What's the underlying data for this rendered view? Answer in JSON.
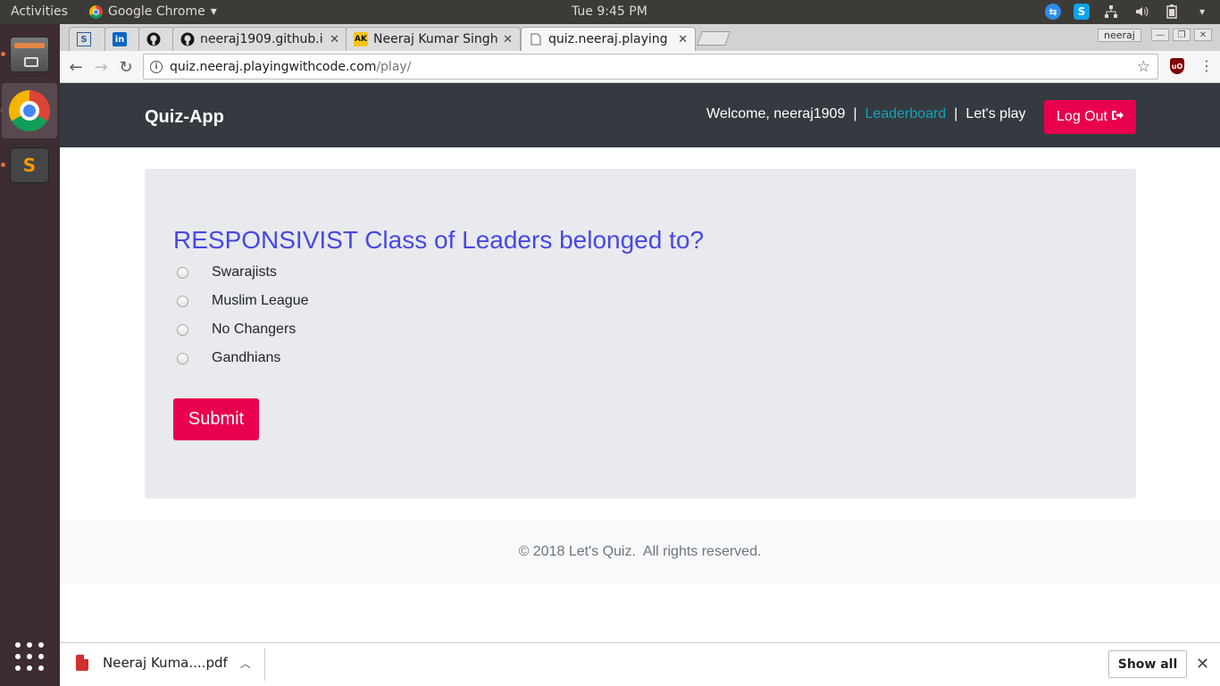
{
  "top_panel": {
    "activities": "Activities",
    "app_name": "Google Chrome",
    "app_menu_arrow": "▾",
    "clock": "Tue  9:45 PM"
  },
  "launcher": {
    "items": [
      "Files",
      "Google Chrome",
      "Sublime Text"
    ],
    "sublime_glyph": "S"
  },
  "browser": {
    "tabs": [
      {
        "favicon": "S",
        "title": ""
      },
      {
        "favicon": "in",
        "title": ""
      },
      {
        "favicon": "github",
        "title": ""
      },
      {
        "favicon": "github",
        "title": "neeraj1909.github.i",
        "close": "✕"
      },
      {
        "favicon": "AK",
        "title": "Neeraj Kumar Singh",
        "close": "✕"
      },
      {
        "favicon": "doc",
        "title": "quiz.neeraj.playing",
        "close": "✕"
      }
    ],
    "profile_name": "neeraj",
    "url_host": "quiz.neeraj.playingwithcode.com",
    "url_path": "/play/",
    "ublock_label": "uO"
  },
  "page": {
    "brand": "Quiz-App",
    "welcome": "Welcome, neeraj1909",
    "separator": "|",
    "leaderboard": "Leaderboard",
    "lets_play": "Let's play",
    "logout": "Log Out",
    "question": "RESPONSIVIST Class of Leaders belonged to?",
    "options": [
      "Swarajists",
      "Muslim League",
      "No Changers",
      "Gandhians"
    ],
    "submit": "Submit",
    "footer": "© 2018 Let's Quiz.  All rights reserved."
  },
  "download_shelf": {
    "file_name": "Neeraj Kuma....pdf",
    "show_all": "Show all"
  },
  "colors": {
    "accent": "#e8004e",
    "navbar": "#343a40",
    "question": "#4848e3",
    "link": "#17a2b8"
  }
}
